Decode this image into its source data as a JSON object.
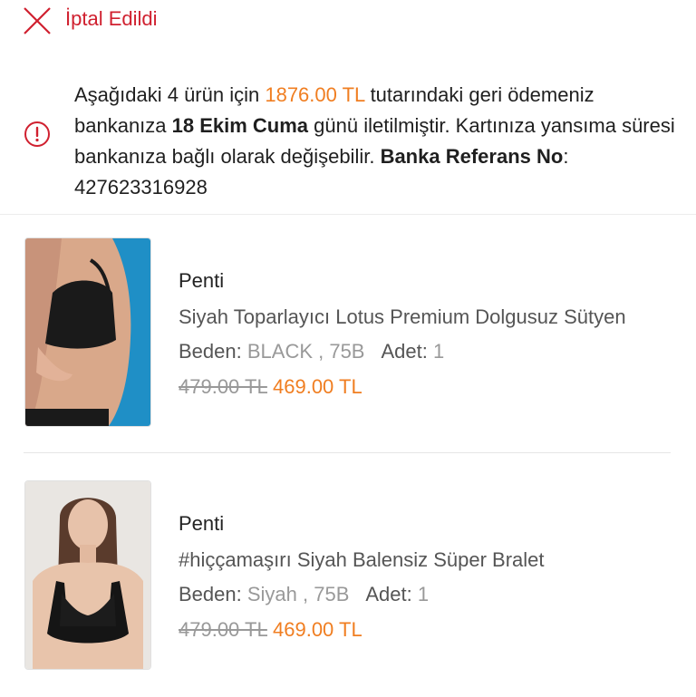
{
  "status": {
    "label": "İptal Edildi",
    "icon": "close-icon",
    "color": "#d0202f"
  },
  "refund_notice": {
    "icon": "info-icon",
    "part1": "Aşağıdaki 4 ürün için ",
    "amount": "1876.00 TL",
    "part2": " tutarındaki geri ödemeniz bankanıza ",
    "date": "18 Ekim Cuma",
    "part3": " günü iletilmiştir. Kartınıza yansıma süresi bankanıza bağlı olarak değişebilir. ",
    "ref_label": "Banka Referans No",
    "ref_sep": ": ",
    "ref_number": "427623316928",
    "accent_color": "#f07e21"
  },
  "products": [
    {
      "brand": "Penti",
      "title": "Siyah Toparlayıcı Lotus Premium Dolgusuz Sütyen",
      "size_label": "Beden:",
      "size_value": "BLACK , 75B",
      "qty_label": "Adet:",
      "qty_value": "1",
      "old_price": "479.00 TL",
      "new_price": "469.00 TL"
    },
    {
      "brand": "Penti",
      "title": "#hiççamaşırı Siyah Balensiz Süper Bralet",
      "size_label": "Beden:",
      "size_value": "Siyah , 75B",
      "qty_label": "Adet:",
      "qty_value": "1",
      "old_price": "479.00 TL",
      "new_price": "469.00 TL"
    }
  ]
}
